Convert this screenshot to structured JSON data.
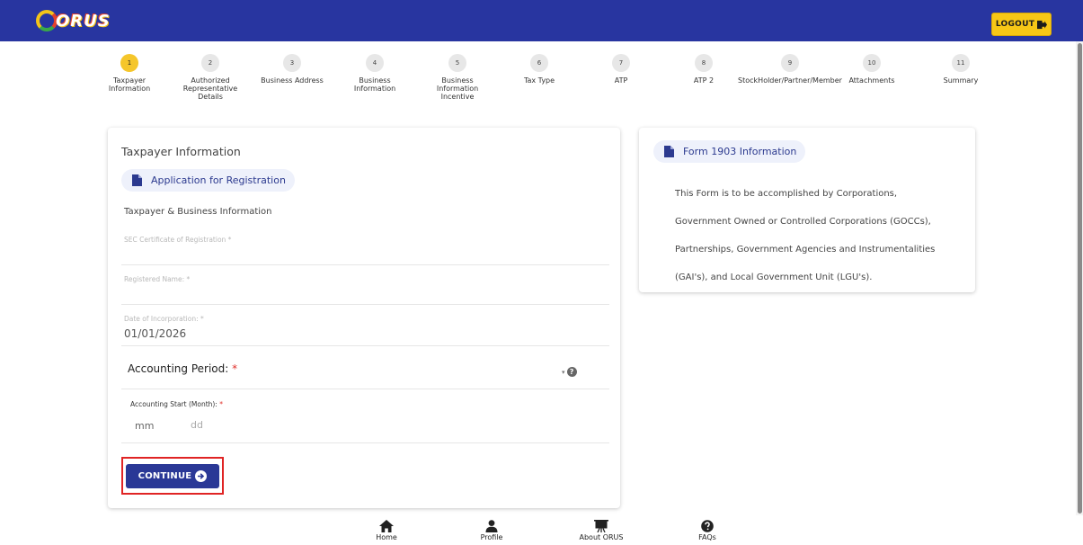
{
  "header": {
    "logo_text": "ORUS",
    "logout_label": "LOGOUT"
  },
  "stepper": {
    "steps": [
      {
        "number": "1",
        "label": "Taxpayer Information",
        "active": true
      },
      {
        "number": "2",
        "label": "Authorized Representative Details",
        "active": false
      },
      {
        "number": "3",
        "label": "Business Address",
        "active": false
      },
      {
        "number": "4",
        "label": "Business Information",
        "active": false
      },
      {
        "number": "5",
        "label": "Business Information Incentive",
        "active": false
      },
      {
        "number": "6",
        "label": "Tax Type",
        "active": false
      },
      {
        "number": "7",
        "label": "ATP",
        "active": false
      },
      {
        "number": "8",
        "label": "ATP 2",
        "active": false
      },
      {
        "number": "9",
        "label": "StockHolder/Partner/Member",
        "active": false
      },
      {
        "number": "10",
        "label": "Attachments",
        "active": false
      },
      {
        "number": "11",
        "label": "Summary",
        "active": false
      }
    ]
  },
  "form": {
    "title": "Taxpayer Information",
    "chip_label": "Application for Registration",
    "section_title": "Taxpayer & Business Information",
    "sec_cert_label": "SEC Certificate of Registration *",
    "sec_cert_value": "",
    "registered_name_label": "Registered Name: *",
    "registered_name_value": "",
    "date_incorporation_label": "Date of Incorporation: *",
    "date_incorporation_value": "01/01/2026",
    "accounting_period_label": "Accounting Period:",
    "accounting_period_required": "*",
    "accounting_period_caret": "▾",
    "help_glyph": "?",
    "accounting_start_label": "Accounting Start (Month):",
    "accounting_start_required": "*",
    "month_placeholder": "mm",
    "day_placeholder": "dd",
    "continue_label": "CONTINUE"
  },
  "info": {
    "chip_label": "Form 1903 Information",
    "lines": [
      "This Form is to be accomplished by Corporations,",
      "Government Owned or Controlled Corporations (GOCCs),",
      "Partnerships, Government Agencies and Instrumentalities",
      "(GAI's), and Local Government Unit (LGU's)."
    ]
  },
  "bottom_nav": {
    "items": [
      {
        "label": "Home",
        "icon": "home-icon"
      },
      {
        "label": "Profile",
        "icon": "profile-icon"
      },
      {
        "label": "About ORUS",
        "icon": "presentation-icon"
      },
      {
        "label": "FAQs",
        "icon": "help-icon"
      }
    ]
  },
  "colors": {
    "header_bg": "#2835a0",
    "accent_yellow": "#f7c716",
    "primary_button": "#2a3896",
    "highlight_border": "#e02424"
  }
}
